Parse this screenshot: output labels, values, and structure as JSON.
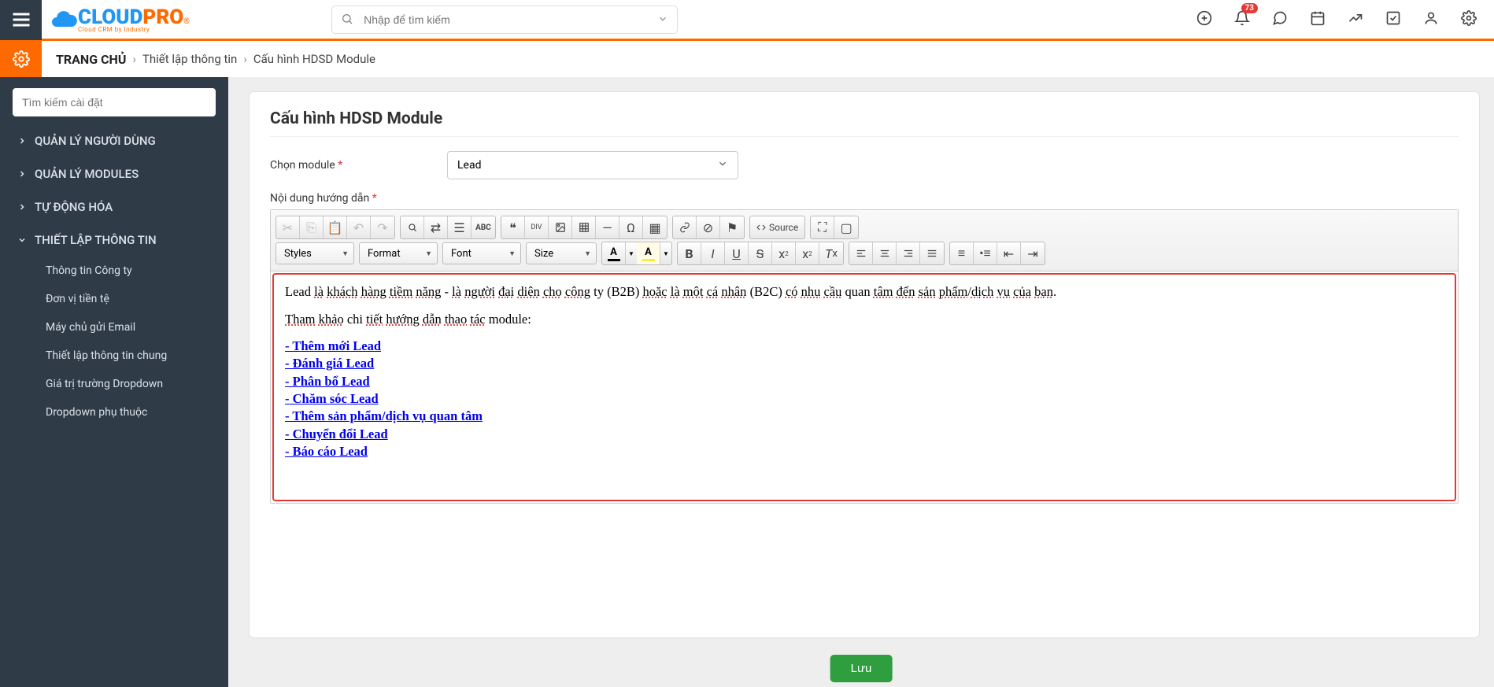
{
  "header": {
    "search_placeholder": "Nhập để tìm kiếm",
    "notification_count": "73"
  },
  "breadcrumb": {
    "home": "TRANG CHỦ",
    "level1": "Thiết lập thông tin",
    "level2": "Cấu hình HDSD Module"
  },
  "sidebar": {
    "search_placeholder": "Tìm kiếm cài đặt",
    "sections": [
      {
        "label": "QUẢN LÝ NGƯỜI DÙNG",
        "expanded": false
      },
      {
        "label": "QUẢN LÝ MODULES",
        "expanded": false
      },
      {
        "label": "TỰ ĐỘNG HÓA",
        "expanded": false
      },
      {
        "label": "THIẾT LẬP THÔNG TIN",
        "expanded": true
      }
    ],
    "subitems": [
      "Thông tin Công ty",
      "Đơn vị tiền tệ",
      "Máy chủ gửi Email",
      "Thiết lập thông tin chung",
      "Giá trị trường Dropdown",
      "Dropdown phụ thuộc"
    ]
  },
  "page": {
    "title": "Cấu hình HDSD Module",
    "module_label": "Chọn module",
    "module_value": "Lead",
    "content_label": "Nội dung hướng dẫn",
    "save_btn": "Lưu"
  },
  "toolbar": {
    "styles": "Styles",
    "format": "Format",
    "font": "Font",
    "size": "Size",
    "source": "Source"
  },
  "editor": {
    "para1_parts": [
      {
        "t": "Lead ",
        "s": false
      },
      {
        "t": "là",
        "s": true
      },
      {
        "t": " ",
        "s": false
      },
      {
        "t": "khách",
        "s": true
      },
      {
        "t": " ",
        "s": false
      },
      {
        "t": "hàng",
        "s": true
      },
      {
        "t": " ",
        "s": false
      },
      {
        "t": "tiềm",
        "s": true
      },
      {
        "t": " ",
        "s": false
      },
      {
        "t": "năng",
        "s": true
      },
      {
        "t": " - ",
        "s": false
      },
      {
        "t": "là",
        "s": true
      },
      {
        "t": " ",
        "s": false
      },
      {
        "t": "người",
        "s": true
      },
      {
        "t": " ",
        "s": false
      },
      {
        "t": "đại",
        "s": true
      },
      {
        "t": " ",
        "s": false
      },
      {
        "t": "diện",
        "s": true
      },
      {
        "t": " ",
        "s": false
      },
      {
        "t": "cho",
        "s": true
      },
      {
        "t": " ",
        "s": false
      },
      {
        "t": "công",
        "s": true
      },
      {
        "t": " ty (B2B) ",
        "s": false
      },
      {
        "t": "hoặc",
        "s": true
      },
      {
        "t": " ",
        "s": false
      },
      {
        "t": "là",
        "s": true
      },
      {
        "t": " ",
        "s": false
      },
      {
        "t": "một",
        "s": true
      },
      {
        "t": " ",
        "s": false
      },
      {
        "t": "cá",
        "s": true
      },
      {
        "t": " ",
        "s": false
      },
      {
        "t": "nhân",
        "s": true
      },
      {
        "t": " (B2C) ",
        "s": false
      },
      {
        "t": "có",
        "s": true
      },
      {
        "t": " ",
        "s": false
      },
      {
        "t": "nhu",
        "s": true
      },
      {
        "t": " ",
        "s": false
      },
      {
        "t": "cầu",
        "s": true
      },
      {
        "t": " quan ",
        "s": false
      },
      {
        "t": "tâm",
        "s": true
      },
      {
        "t": " ",
        "s": false
      },
      {
        "t": "đến",
        "s": true
      },
      {
        "t": " ",
        "s": false
      },
      {
        "t": "sản",
        "s": true
      },
      {
        "t": " ",
        "s": false
      },
      {
        "t": "phẩm",
        "s": true
      },
      {
        "t": "/",
        "s": false
      },
      {
        "t": "dịch",
        "s": true
      },
      {
        "t": " ",
        "s": false
      },
      {
        "t": "vụ",
        "s": true
      },
      {
        "t": " ",
        "s": false
      },
      {
        "t": "của",
        "s": true
      },
      {
        "t": " ",
        "s": false
      },
      {
        "t": "bạn",
        "s": true
      },
      {
        "t": ".",
        "s": false
      }
    ],
    "para2_prefix_spell": [
      "Tham",
      "khảo"
    ],
    "para2_mid": " chi ",
    "para2_spell2": [
      "tiết",
      "hướng",
      "dẫn",
      "thao",
      "tác"
    ],
    "para2_suffix": " module:",
    "links": [
      "- Thêm mới Lead",
      "- Đánh giá Lead",
      "- Phân bổ Lead",
      "- Chăm sóc Lead",
      "- Thêm sản phẩm/dịch vụ quan tâm",
      "- Chuyển đổi Lead",
      "- Báo cáo Lead"
    ]
  }
}
